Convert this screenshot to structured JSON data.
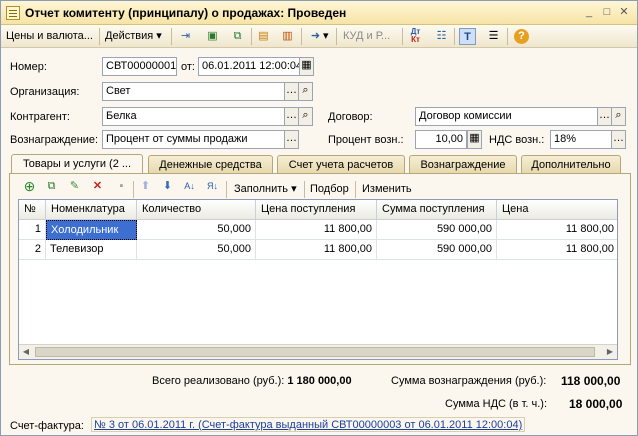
{
  "window": {
    "title": "Отчет комитенту (принципалу) о продажах: Проведен",
    "minimize_icon": "minimize-icon",
    "maximize_icon": "maximize-icon",
    "close_icon": "close-icon"
  },
  "toolbar": {
    "prices_label": "Цены и валюта...",
    "actions_label": "Действия",
    "kudr_label": "КУД и Р...",
    "dt_label": "Дт",
    "kt_label": "Кт"
  },
  "form": {
    "number_label": "Номер:",
    "number_value": "СВТ00000001",
    "from_label": "от:",
    "date_value": "06.01.2011 12:00:04",
    "org_label": "Организация:",
    "org_value": "Свет",
    "contractor_label": "Контрагент:",
    "contractor_value": "Белка",
    "contract_label": "Договор:",
    "contract_value": "Договор комиссии",
    "reward_label": "Вознаграждение:",
    "reward_value": "Процент от суммы продажи",
    "percent_label": "Процент возн.:",
    "percent_value": "10,00",
    "vat_label": "НДС возн.:",
    "vat_value": "18%"
  },
  "tabs": [
    {
      "label": "Товары и услуги (2 ..."
    },
    {
      "label": "Денежные средства"
    },
    {
      "label": "Счет учета расчетов"
    },
    {
      "label": "Вознаграждение"
    },
    {
      "label": "Дополнительно"
    }
  ],
  "table_toolbar": {
    "fill_label": "Заполнить",
    "select_label": "Подбор",
    "change_label": "Изменить"
  },
  "table": {
    "columns": [
      "№",
      "Номенклатура",
      "Количество",
      "Цена поступления",
      "Сумма поступления",
      "Цена"
    ],
    "rows": [
      [
        "1",
        "Холодильник",
        "50,000",
        "11 800,00",
        "590 000,00",
        "11 800,00"
      ],
      [
        "2",
        "Телевизор",
        "50,000",
        "11 800,00",
        "590 000,00",
        "11 800,00"
      ]
    ]
  },
  "totals": {
    "sold_label": "Всего реализовано (руб.):",
    "sold_value": "1 180 000,00",
    "reward_label": "Сумма вознаграждения (руб.):",
    "reward_value": "118 000,00",
    "vat_label": "Сумма НДС (в т. ч.):",
    "vat_value": "18 000,00"
  },
  "invoice": {
    "label": "Счет-фактура:",
    "link": "№ 3 от 06.01.2011 г. (Счет-фактура выданный СВТ00000003 от 06.01.2011 12:00:04)"
  },
  "colors": {
    "accent": "#3c6fd0",
    "background": "#fbf7ee"
  }
}
